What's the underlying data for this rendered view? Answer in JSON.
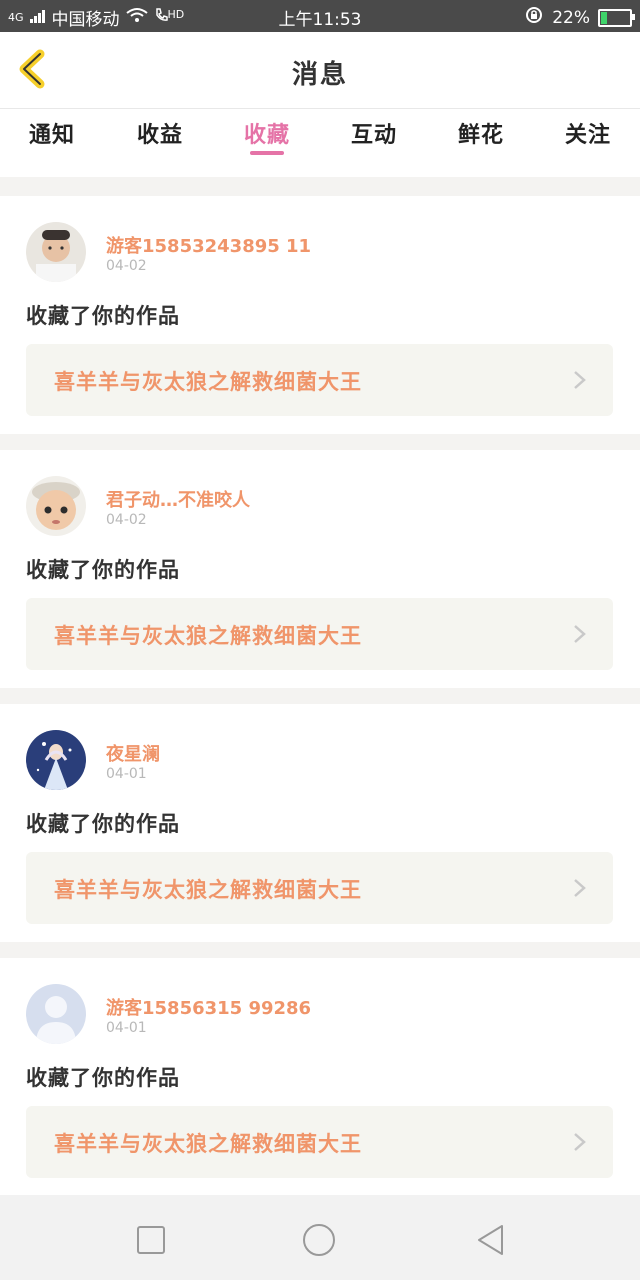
{
  "status_bar": {
    "network": "4G",
    "carrier": "中国移动",
    "hd": "HD",
    "time": "上午11:53",
    "battery": "22%",
    "battery_level": 0.22
  },
  "header": {
    "title": "消息",
    "back_icon": "chevron-left-icon"
  },
  "tabs": [
    {
      "label": "通知",
      "active": false
    },
    {
      "label": "收益",
      "active": false
    },
    {
      "label": "收藏",
      "active": true
    },
    {
      "label": "互动",
      "active": false
    },
    {
      "label": "鲜花",
      "active": false
    },
    {
      "label": "关注",
      "active": false
    }
  ],
  "messages": [
    {
      "user": "游客15853243895 11",
      "date": "04-02",
      "action": "收藏了你的作品",
      "work": "喜羊羊与灰太狼之解救细菌大王"
    },
    {
      "user": "君子动…不准咬人",
      "date": "04-02",
      "action": "收藏了你的作品",
      "work": "喜羊羊与灰太狼之解救细菌大王"
    },
    {
      "user": "夜星澜",
      "date": "04-01",
      "action": "收藏了你的作品",
      "work": "喜羊羊与灰太狼之解救细菌大王"
    },
    {
      "user": "游客15856315 99286",
      "date": "04-01",
      "action": "收藏了你的作品",
      "work": "喜羊羊与灰太狼之解救细菌大王"
    }
  ],
  "colors": {
    "accent_pink": "#e573a7",
    "orange_text": "#f0956a",
    "back_yellow": "#f6cf2b"
  },
  "nav": [
    "square-icon",
    "circle-icon",
    "triangle-back-icon"
  ]
}
